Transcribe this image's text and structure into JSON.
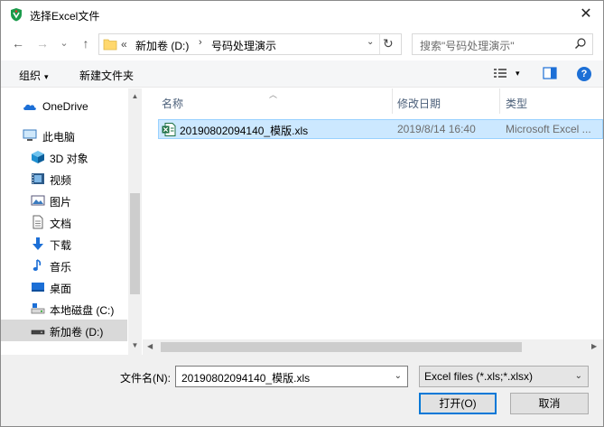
{
  "window": {
    "title": "选择Excel文件",
    "close_glyph": "✕"
  },
  "nav": {
    "back_glyph": "←",
    "forward_glyph": "→",
    "recent_glyph": "⌄",
    "up_glyph": "↑",
    "breadcrumb": [
      {
        "label": "«"
      },
      {
        "label": "新加卷 (D:)"
      },
      {
        "label": "号码处理演示"
      }
    ],
    "crumb_sep": "›",
    "dropdown_glyph": "⌄",
    "refresh_glyph": "↻"
  },
  "search": {
    "placeholder": "搜索\"号码处理演示\""
  },
  "toolbar": {
    "organize_label": "组织",
    "new_folder_label": "新建文件夹",
    "caret": "▾"
  },
  "sidebar": {
    "items": [
      {
        "label": "OneDrive",
        "icon": "cloud-icon"
      },
      {
        "label": "此电脑",
        "icon": "computer-icon"
      },
      {
        "label": "3D 对象",
        "icon": "cube-icon"
      },
      {
        "label": "视频",
        "icon": "video-icon"
      },
      {
        "label": "图片",
        "icon": "picture-icon"
      },
      {
        "label": "文档",
        "icon": "document-icon"
      },
      {
        "label": "下载",
        "icon": "download-icon"
      },
      {
        "label": "音乐",
        "icon": "music-icon"
      },
      {
        "label": "桌面",
        "icon": "desktop-icon"
      },
      {
        "label": "本地磁盘 (C:)",
        "icon": "drive-icon"
      },
      {
        "label": "新加卷 (D:)",
        "icon": "drive-icon"
      }
    ]
  },
  "filelist": {
    "columns": {
      "name": "名称",
      "modified": "修改日期",
      "type": "类型"
    },
    "rows": [
      {
        "name": "20190802094140_模版.xls",
        "modified": "2019/8/14 16:40",
        "type": "Microsoft Excel ..."
      }
    ]
  },
  "bottom": {
    "filename_label": "文件名(N):",
    "filename_value": "20190802094140_模版.xls",
    "filter_value": "Excel files (*.xls;*.xlsx)",
    "open_label": "打开(O)",
    "cancel_label": "取消"
  },
  "colors": {
    "accent": "#0078d7",
    "selection": "#cce8ff",
    "excel_green": "#1d7044"
  }
}
